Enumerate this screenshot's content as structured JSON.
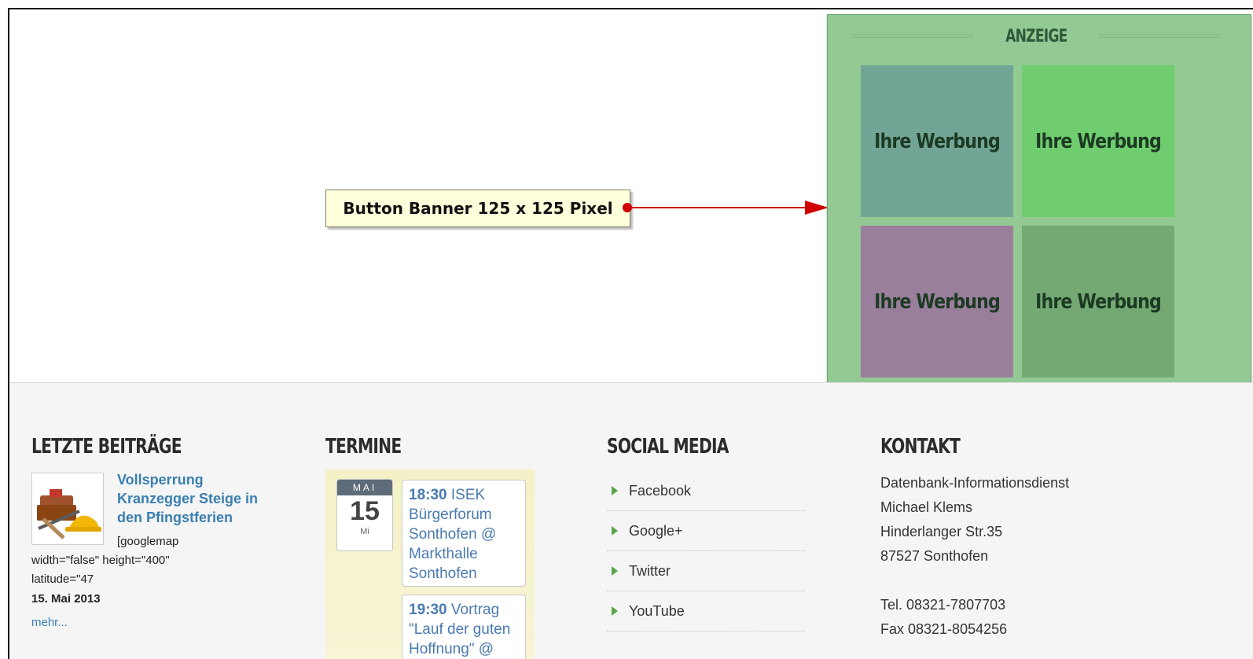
{
  "callout": {
    "label": "Button Banner 125 x 125 Pixel"
  },
  "ads": {
    "header": "ANZEIGE",
    "banners": [
      "Ihre Werbung",
      "Ihre Werbung",
      "Ihre Werbung",
      "Ihre Werbung"
    ],
    "colors": {
      "panel": "#93c993",
      "banner1": "#73a596",
      "banner2": "#6fcd6f",
      "banner3": "#9a7f9d",
      "banner4": "#74a974"
    }
  },
  "footer": {
    "latest_posts": {
      "title": "LETZTE BEITRÄGE",
      "post": {
        "title": "Vollsperrung Kranzegger Steige in den Pfingstferien",
        "excerpt_1": "[googlemap",
        "excerpt_2": "width=\"false\" height=\"400\"",
        "excerpt_3": "latitude=\"47",
        "date": "15. Mai 2013",
        "more": "mehr..."
      }
    },
    "events": {
      "title": "TERMINE",
      "date": {
        "month": "MAI",
        "day": "15",
        "weekday": "Mi"
      },
      "items": [
        {
          "time": "18:30",
          "text": "ISEK Bürgerforum Sonthofen @ Markthalle Sonthofen"
        },
        {
          "time": "19:30",
          "text": "Vortrag \"Lauf der guten Hoffnung\" @"
        }
      ]
    },
    "social": {
      "title": "SOCIAL MEDIA",
      "items": [
        "Facebook",
        "Google+",
        "Twitter",
        "YouTube"
      ]
    },
    "contact": {
      "title": "KONTAKT",
      "lines": [
        "Datenbank-Informationsdienst",
        "Michael Klems",
        "Hinderlanger Str.35",
        "87527 Sonthofen",
        "",
        "Tel. 08321-7807703",
        "Fax 08321-8054256"
      ]
    }
  }
}
